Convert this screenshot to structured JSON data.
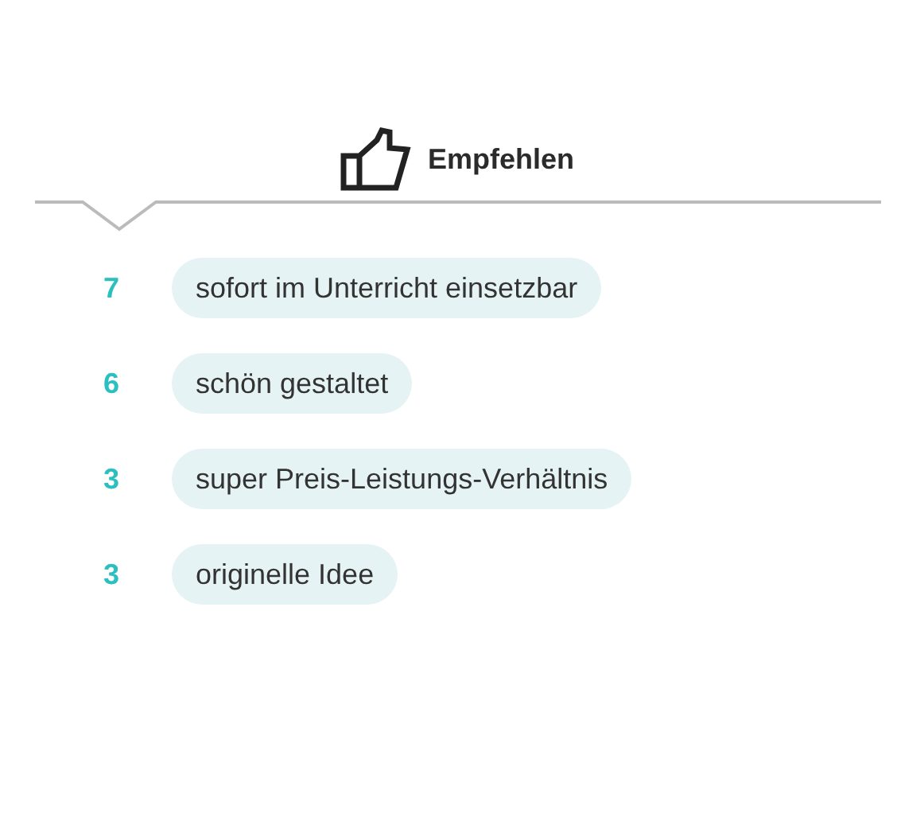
{
  "heading": {
    "label": "Empfehlen"
  },
  "recommendations": [
    {
      "count": "7",
      "label": "sofort im Unterricht einsetzbar"
    },
    {
      "count": "6",
      "label": "schön gestaltet"
    },
    {
      "count": "3",
      "label": "super Preis-Leistungs-Verhältnis"
    },
    {
      "count": "3",
      "label": "originelle Idee"
    }
  ]
}
